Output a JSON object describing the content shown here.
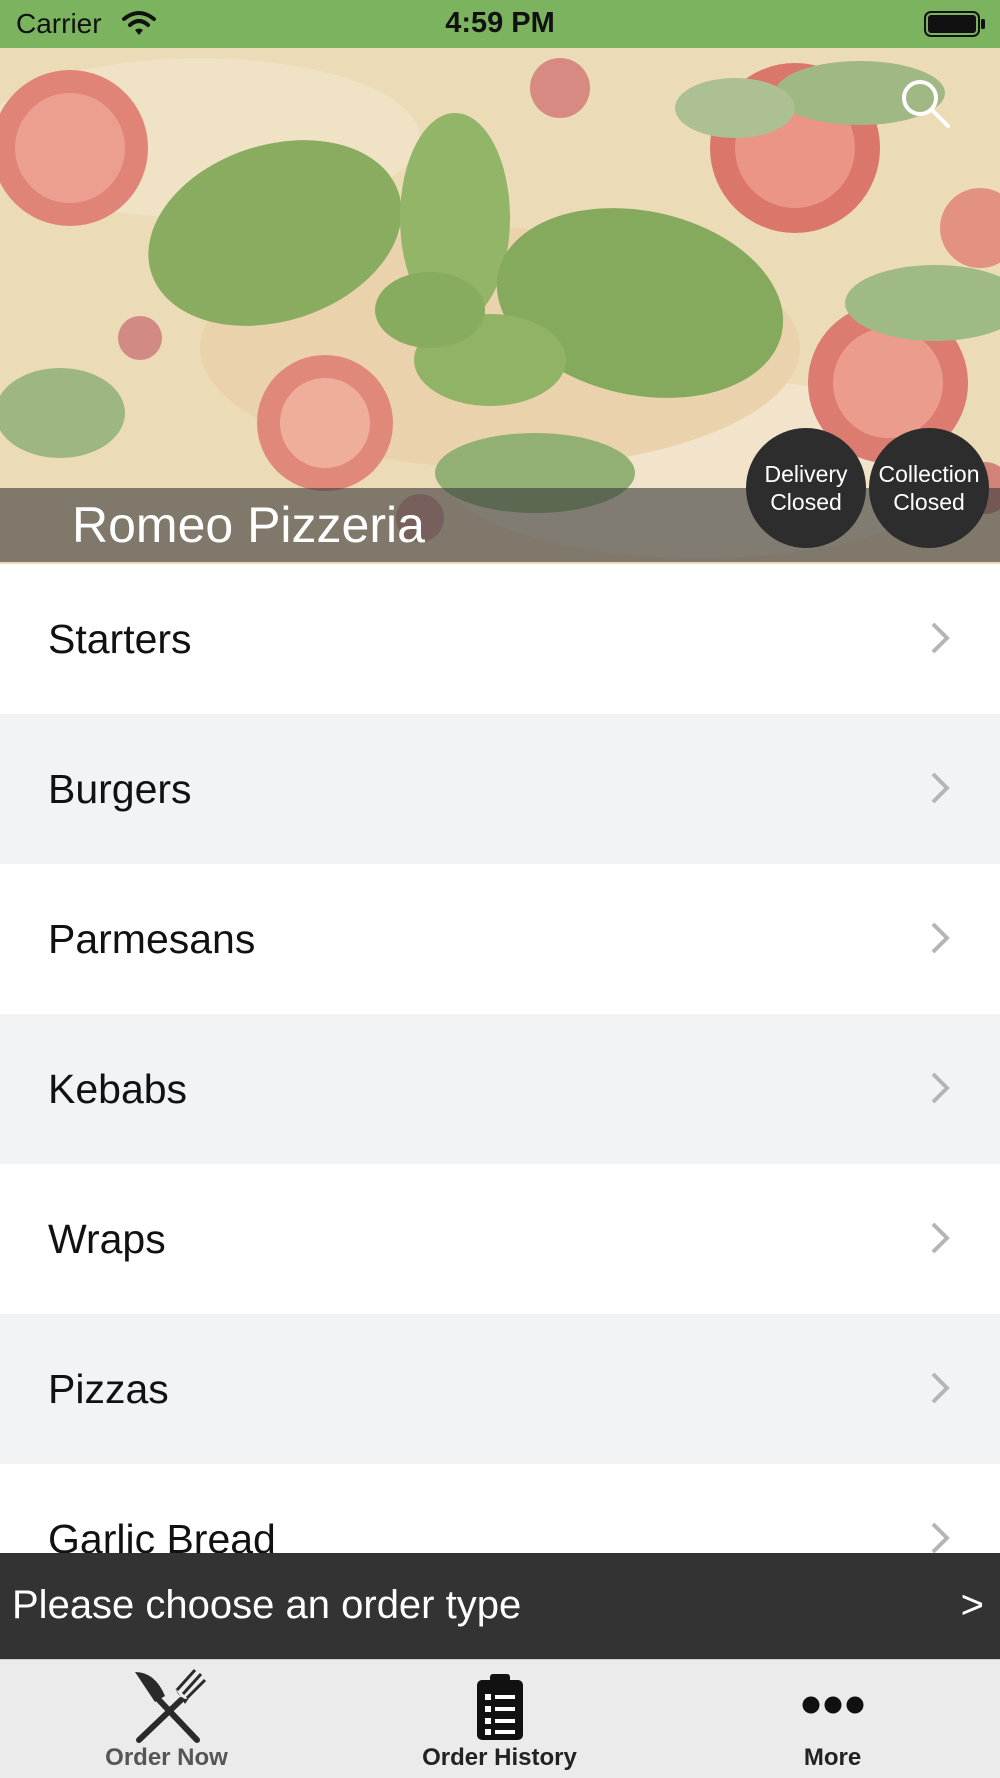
{
  "status_bar": {
    "carrier": "Carrier",
    "time": "4:59 PM"
  },
  "hero": {
    "restaurant_name": "Romeo Pizzeria",
    "delivery": {
      "line1": "Delivery",
      "line2": "Closed"
    },
    "collection": {
      "line1": "Collection",
      "line2": "Closed"
    }
  },
  "menu": {
    "items": [
      {
        "label": "Starters"
      },
      {
        "label": "Burgers"
      },
      {
        "label": "Parmesans"
      },
      {
        "label": "Kebabs"
      },
      {
        "label": "Wraps"
      },
      {
        "label": "Pizzas"
      },
      {
        "label": "Garlic Bread"
      }
    ]
  },
  "order_bar": {
    "prompt": "Please choose an order type",
    "arrow": ">"
  },
  "tab_bar": {
    "tabs": [
      {
        "label": "Order Now",
        "icon": "fork-knife-icon"
      },
      {
        "label": "Order History",
        "icon": "clipboard-icon"
      },
      {
        "label": "More",
        "icon": "more-dots-icon"
      }
    ]
  },
  "colors": {
    "status_bar": "#7cb35f",
    "order_bar": "#333333",
    "badge": "#2d2d2d",
    "tab_bar": "#ebebeb"
  }
}
